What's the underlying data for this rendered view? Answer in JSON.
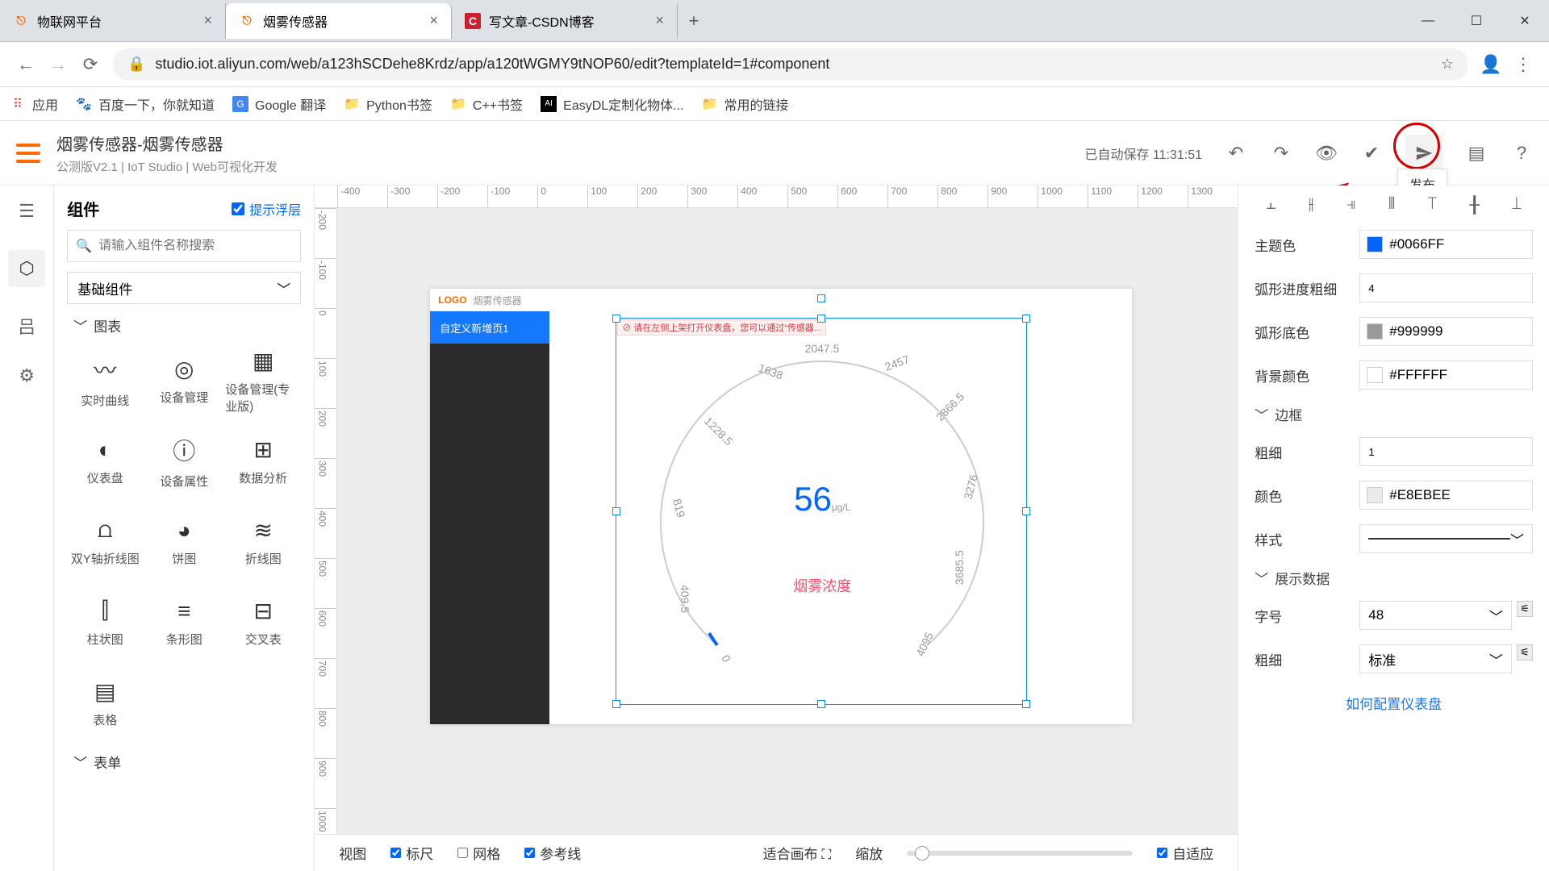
{
  "browser": {
    "tabs": [
      {
        "title": "物联网平台",
        "favicon": "⎋",
        "color": "#ff6a00"
      },
      {
        "title": "烟雾传感器",
        "favicon": "⎋",
        "color": "#ff6a00",
        "active": true
      },
      {
        "title": "写文章-CSDN博客",
        "favicon": "C",
        "color": "#c8202f"
      }
    ],
    "url": "studio.iot.aliyun.com/web/a123hSCDehe8Krdz/app/a120tWGMY9tNOP60/edit?templateId=1#component",
    "bookmarks": [
      {
        "label": "应用",
        "icon": "⠿",
        "color": "#666"
      },
      {
        "label": "百度一下，你就知道",
        "icon": "🐾",
        "color": "#2b7cd3"
      },
      {
        "label": "Google 翻译",
        "icon": "G",
        "color": "#4285f4"
      },
      {
        "label": "Python书签",
        "icon": "📁",
        "color": "#f6b73c"
      },
      {
        "label": "C++书签",
        "icon": "📁",
        "color": "#f6b73c"
      },
      {
        "label": "EasyDL定制化物体...",
        "icon": "AI",
        "color": "#000"
      },
      {
        "label": "常用的链接",
        "icon": "📁",
        "color": "#f6b73c"
      }
    ]
  },
  "app_header": {
    "title": "烟雾传感器-烟雾传感器",
    "subtitle": "公测版V2.1 | IoT Studio | Web可视化开发",
    "autosave": "已自动保存 11:31:51",
    "publish_tooltip": "发布"
  },
  "components": {
    "heading": "组件",
    "hint_label": "提示浮层",
    "search_placeholder": "请输入组件名称搜索",
    "category": "基础组件",
    "section": "图表",
    "items": [
      {
        "icon": "〰",
        "label": "实时曲线"
      },
      {
        "icon": "◎",
        "label": "设备管理"
      },
      {
        "icon": "▦",
        "label": "设备管理(专业版)"
      },
      {
        "icon": "◐",
        "label": "仪表盘"
      },
      {
        "icon": "ⓘ",
        "label": "设备属性"
      },
      {
        "icon": "⊞",
        "label": "数据分析"
      },
      {
        "icon": "⩍",
        "label": "双Y轴折线图"
      },
      {
        "icon": "◕",
        "label": "饼图"
      },
      {
        "icon": "≋",
        "label": "折线图"
      },
      {
        "icon": "⫿",
        "label": "柱状图"
      },
      {
        "icon": "≡",
        "label": "条形图"
      },
      {
        "icon": "⊟",
        "label": "交叉表"
      },
      {
        "icon": "▤",
        "label": "表格"
      }
    ],
    "next_section": "表单"
  },
  "ruler_h": [
    "-400",
    "-300",
    "-200",
    "-100",
    "0",
    "100",
    "200",
    "300",
    "400",
    "500",
    "600",
    "700",
    "800",
    "900",
    "1000",
    "1100",
    "1200",
    "1300"
  ],
  "ruler_v": [
    "-200",
    "-100",
    "0",
    "100",
    "200",
    "300",
    "400",
    "500",
    "600",
    "700",
    "800",
    "900",
    "1000"
  ],
  "artboard": {
    "logo": "LOGO",
    "logo_sub": "烟雾传感器",
    "nav_item": "自定义新增页1",
    "warn": "请在左侧上架打开仪表盘，您可以通过“传感器...",
    "gauge": {
      "value": "56",
      "unit": "μg/L",
      "label": "烟雾浓度",
      "ticks": [
        "0",
        "409.5",
        "819",
        "1228.5",
        "1638",
        "2047.5",
        "2457",
        "2866.5",
        "3276",
        "3685.5",
        "4095"
      ]
    }
  },
  "statusbar": {
    "view": "视图",
    "ruler": "标尺",
    "grid": "网格",
    "guides": "参考线",
    "fit": "适合画布",
    "zoom": "缩放",
    "adaptive": "自适应"
  },
  "right": {
    "theme_color_lbl": "主题色",
    "theme_color": "#0066FF",
    "arc_width_lbl": "弧形进度粗细",
    "arc_width": "4",
    "arc_bg_lbl": "弧形底色",
    "arc_bg": "#999999",
    "bg_color_lbl": "背景颜色",
    "bg_color": "#FFFFFF",
    "border_section": "边框",
    "border_w_lbl": "粗细",
    "border_w": "1",
    "border_c_lbl": "颜色",
    "border_c": "#E8EBEE",
    "border_s_lbl": "样式",
    "data_section": "展示数据",
    "font_size_lbl": "字号",
    "font_size": "48",
    "font_weight_lbl": "粗细",
    "font_weight": "标准",
    "help": "如何配置仪表盘"
  },
  "chart_data": {
    "type": "gauge",
    "title": "烟雾浓度",
    "value": 56,
    "unit": "μg/L",
    "min": 0,
    "max": 4095,
    "ticks": [
      0,
      409.5,
      819,
      1228.5,
      1638,
      2047.5,
      2457,
      2866.5,
      3276,
      3685.5,
      4095
    ],
    "arc_color": "#0066FF",
    "arc_bg": "#999999"
  }
}
